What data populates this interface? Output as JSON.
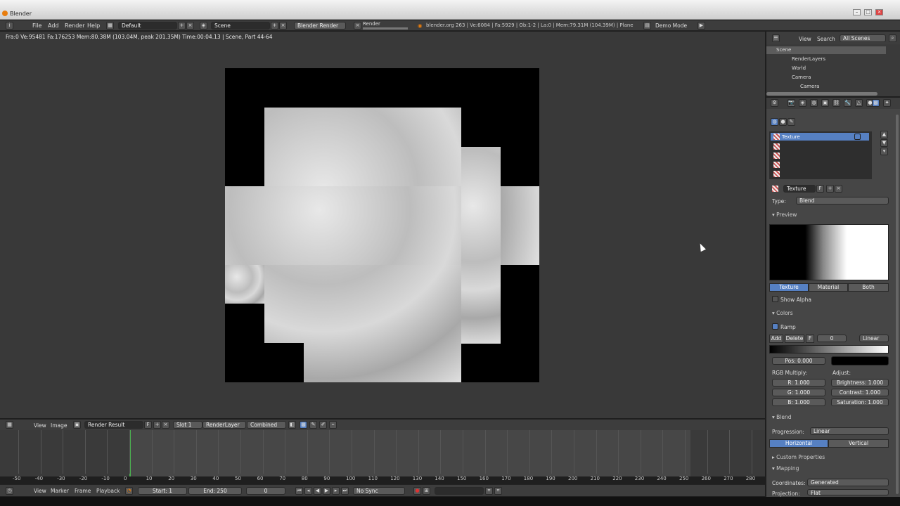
{
  "window": {
    "title": "Blender"
  },
  "topbar": {
    "menus": [
      "File",
      "Add",
      "Render",
      "Help"
    ],
    "layout": "Default",
    "scene": "Scene",
    "engine": "Blender Render",
    "render_tab": "Render",
    "info": "blender.org 263 | Ve:6084 | Fa:5929 | Ob:1-2 | La:0 | Mem:79.31M (104.39M) | Plane",
    "demo": "Demo Mode"
  },
  "status": {
    "text": "Fra:0  Ve:95481 Fa:176253 Mem:80.38M (103.04M, peak 201.35M) Time:00:04.13 | Scene, Part 44-64"
  },
  "image_header": {
    "menus": [
      "View",
      "Image"
    ],
    "image_name": "Render Result",
    "f_label": "F",
    "slot": "Slot 1",
    "layer": "RenderLayer",
    "pass": "Combined"
  },
  "timeline": {
    "ticks": [
      "-50",
      "-40",
      "-30",
      "-20",
      "-10",
      "0",
      "10",
      "20",
      "30",
      "40",
      "50",
      "60",
      "70",
      "80",
      "90",
      "100",
      "110",
      "120",
      "130",
      "140",
      "150",
      "160",
      "170",
      "180",
      "190",
      "200",
      "210",
      "220",
      "230",
      "240",
      "250",
      "260",
      "270",
      "280"
    ]
  },
  "timeline_header": {
    "menus": [
      "View",
      "Marker",
      "Frame",
      "Playback"
    ],
    "start": "Start: 1",
    "end": "End: 250",
    "current": "0",
    "sync": "No Sync"
  },
  "outliner": {
    "menus": [
      "View",
      "Search"
    ],
    "filter": "All Scenes",
    "items": [
      "Scene",
      "RenderLayers",
      "World",
      "Camera",
      "Camera"
    ]
  },
  "props": {
    "slots": [
      "Texture"
    ],
    "texture_name": "Texture",
    "f_label": "F",
    "type_label": "Type:",
    "type_value": "Blend",
    "preview_label": "Preview",
    "preview_tabs": [
      "Texture",
      "Material",
      "Both"
    ],
    "show_alpha": "Show Alpha",
    "colors_label": "Colors",
    "ramp_label": "Ramp",
    "ramp_buttons": {
      "add": "Add",
      "delete": "Delete",
      "f": "F",
      "index": "0",
      "interp": "Linear"
    },
    "pos": "Pos: 0.000",
    "rgb_multiply": "RGB Multiply:",
    "adjust": "Adjust:",
    "r": "R: 1.000",
    "g": "G: 1.000",
    "b": "B: 1.000",
    "brightness": "Brightness: 1.000",
    "contrast": "Contrast: 1.000",
    "saturation": "Saturation: 1.000",
    "blend_label": "Blend",
    "progression_label": "Progression:",
    "progression_value": "Linear",
    "dir_tabs": [
      "Horizontal",
      "Vertical"
    ],
    "custom_props": "Custom Properties",
    "mapping": "Mapping",
    "coordinates_label": "Coordinates:",
    "coordinates_value": "Generated",
    "projection_label": "Projection:",
    "projection_value": "Flat"
  }
}
